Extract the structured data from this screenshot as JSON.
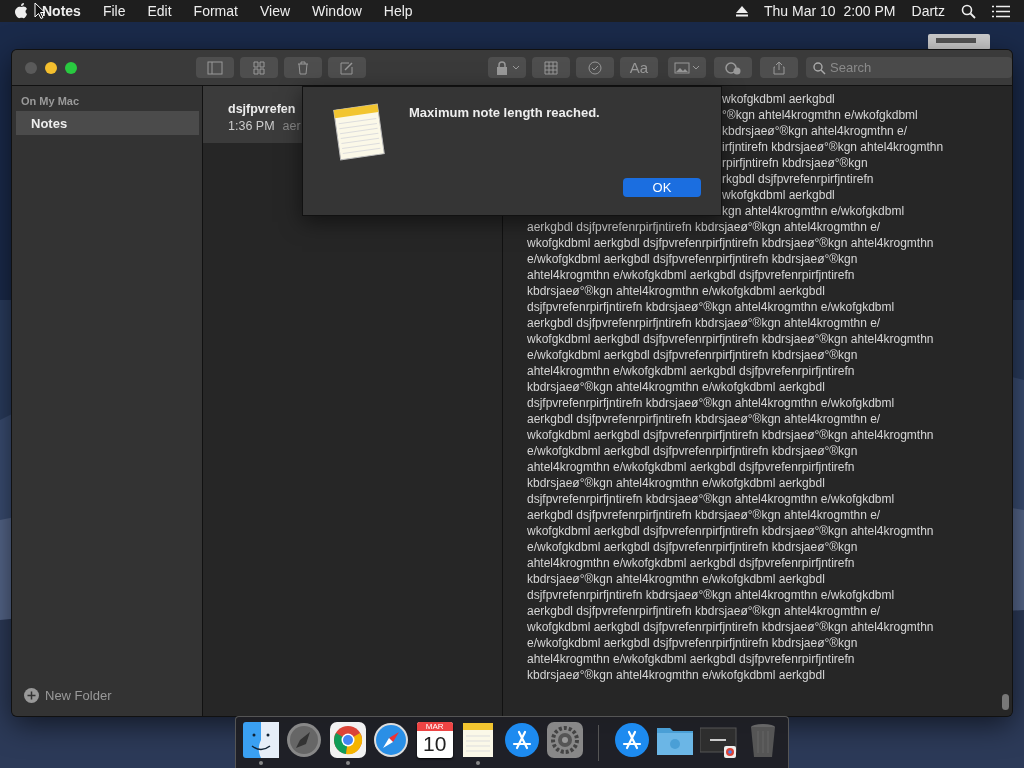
{
  "menu_bar": {
    "app_name": "Notes",
    "menus": [
      "File",
      "Edit",
      "Format",
      "View",
      "Window",
      "Help"
    ],
    "clock": "Thu Mar 10  2:00 PM",
    "user": "Dartz"
  },
  "toolbar": {
    "format_button": "Aa",
    "search": {
      "placeholder": "Search"
    }
  },
  "sidebar": {
    "section": "On My Mac",
    "folders": [
      {
        "name": "Notes",
        "selected": true
      }
    ],
    "new_folder": "New Folder"
  },
  "note_list": [
    {
      "title": "dsjfpvrefen",
      "time": "1:36 PM",
      "preview": "aer",
      "selected": true
    }
  ],
  "note": {
    "lines": [
      {
        "kind": "cut",
        "text": "wkofgkdbml aerkgbdl"
      },
      {
        "kind": "cut",
        "text": "°®kgn ahtel4krogmthn e/wkofgkdbml"
      },
      {
        "kind": "cut",
        "text": "kbdrsjaeø°®kgn ahtel4krogmthn e/"
      },
      {
        "kind": "cut",
        "text": "irfjntirefn kbdrsjaeø°®kgn ahtel4krogmthn"
      },
      {
        "kind": "cut",
        "text": "rpirfjntirefn kbdrsjaeø°®kgn"
      },
      {
        "kind": "cut",
        "text": "rkgbdl dsjfpvrefenrpirfjntirefn"
      },
      {
        "kind": "cut",
        "text": "wkofgkdbml aerkgbdl"
      },
      {
        "kind": "cut",
        "text": "kgn ahtel4krogmthn e/wkofgkdbml"
      },
      {
        "kind": "full",
        "text": "aerkgbdl dsjfpvrefenrpirfjntirefn kbdrsjaeø°®kgn ahtel4krogmthn e/"
      },
      {
        "kind": "full",
        "text": "wkofgkdbml aerkgbdl dsjfpvrefenrpirfjntirefn kbdrsjaeø°®kgn ahtel4krogmthn"
      },
      {
        "kind": "full",
        "text": "e/wkofgkdbml aerkgbdl dsjfpvrefenrpirfjntirefn kbdrsjaeø°®kgn"
      },
      {
        "kind": "full",
        "text": "ahtel4krogmthn e/wkofgkdbml aerkgbdl dsjfpvrefenrpirfjntirefn"
      },
      {
        "kind": "full",
        "text": "kbdrsjaeø°®kgn ahtel4krogmthn e/wkofgkdbml aerkgbdl"
      },
      {
        "kind": "full",
        "text": "dsjfpvrefenrpirfjntirefn kbdrsjaeø°®kgn ahtel4krogmthn e/wkofgkdbml"
      },
      {
        "kind": "full",
        "text": "aerkgbdl dsjfpvrefenrpirfjntirefn kbdrsjaeø°®kgn ahtel4krogmthn e/"
      },
      {
        "kind": "full",
        "text": "wkofgkdbml aerkgbdl dsjfpvrefenrpirfjntirefn kbdrsjaeø°®kgn ahtel4krogmthn"
      },
      {
        "kind": "full",
        "text": "e/wkofgkdbml aerkgbdl dsjfpvrefenrpirfjntirefn kbdrsjaeø°®kgn"
      },
      {
        "kind": "full",
        "text": "ahtel4krogmthn e/wkofgkdbml aerkgbdl dsjfpvrefenrpirfjntirefn"
      },
      {
        "kind": "full",
        "text": "kbdrsjaeø°®kgn ahtel4krogmthn e/wkofgkdbml aerkgbdl"
      },
      {
        "kind": "full",
        "text": "dsjfpvrefenrpirfjntirefn kbdrsjaeø°®kgn ahtel4krogmthn e/wkofgkdbml"
      },
      {
        "kind": "full",
        "text": "aerkgbdl dsjfpvrefenrpirfjntirefn kbdrsjaeø°®kgn ahtel4krogmthn e/"
      },
      {
        "kind": "full",
        "text": "wkofgkdbml aerkgbdl dsjfpvrefenrpirfjntirefn kbdrsjaeø°®kgn ahtel4krogmthn"
      },
      {
        "kind": "full",
        "text": "e/wkofgkdbml aerkgbdl dsjfpvrefenrpirfjntirefn kbdrsjaeø°®kgn"
      },
      {
        "kind": "full",
        "text": "ahtel4krogmthn e/wkofgkdbml aerkgbdl dsjfpvrefenrpirfjntirefn"
      },
      {
        "kind": "full",
        "text": "kbdrsjaeø°®kgn ahtel4krogmthn e/wkofgkdbml aerkgbdl"
      },
      {
        "kind": "full",
        "text": "dsjfpvrefenrpirfjntirefn kbdrsjaeø°®kgn ahtel4krogmthn e/wkofgkdbml"
      },
      {
        "kind": "full",
        "text": "aerkgbdl dsjfpvrefenrpirfjntirefn kbdrsjaeø°®kgn ahtel4krogmthn e/"
      },
      {
        "kind": "full",
        "text": "wkofgkdbml aerkgbdl dsjfpvrefenrpirfjntirefn kbdrsjaeø°®kgn ahtel4krogmthn"
      },
      {
        "kind": "full",
        "text": "e/wkofgkdbml aerkgbdl dsjfpvrefenrpirfjntirefn kbdrsjaeø°®kgn"
      },
      {
        "kind": "full",
        "text": "ahtel4krogmthn e/wkofgkdbml aerkgbdl dsjfpvrefenrpirfjntirefn"
      },
      {
        "kind": "full",
        "text": "kbdrsjaeø°®kgn ahtel4krogmthn e/wkofgkdbml aerkgbdl"
      },
      {
        "kind": "full",
        "text": "dsjfpvrefenrpirfjntirefn kbdrsjaeø°®kgn ahtel4krogmthn e/wkofgkdbml"
      },
      {
        "kind": "full",
        "text": "aerkgbdl dsjfpvrefenrpirfjntirefn kbdrsjaeø°®kgn ahtel4krogmthn e/"
      },
      {
        "kind": "full",
        "text": "wkofgkdbml aerkgbdl dsjfpvrefenrpirfjntirefn kbdrsjaeø°®kgn ahtel4krogmthn"
      },
      {
        "kind": "full",
        "text": "e/wkofgkdbml aerkgbdl dsjfpvrefenrpirfjntirefn kbdrsjaeø°®kgn"
      },
      {
        "kind": "full",
        "text": "ahtel4krogmthn e/wkofgkdbml aerkgbdl dsjfpvrefenrpirfjntirefn"
      },
      {
        "kind": "full",
        "text": "kbdrsjaeø°®kgn ahtel4krogmthn e/wkofgkdbml aerkgbdl"
      }
    ]
  },
  "dialog": {
    "message": "Maximum note length reached.",
    "button": "OK"
  },
  "dock": {
    "items": [
      {
        "kind": "finder",
        "running": true
      },
      {
        "kind": "launchpad",
        "running": false
      },
      {
        "kind": "chrome",
        "running": true
      },
      {
        "kind": "safari",
        "running": false
      },
      {
        "kind": "calendar",
        "month": "MAR",
        "day": "10",
        "running": false
      },
      {
        "kind": "notes",
        "running": true
      },
      {
        "kind": "appstore",
        "running": false
      },
      {
        "kind": "settings",
        "running": false
      },
      {
        "kind": "separator"
      },
      {
        "kind": "appstore",
        "running": false
      },
      {
        "kind": "folder",
        "running": false
      },
      {
        "kind": "screenshot",
        "running": false
      },
      {
        "kind": "trash",
        "running": false
      }
    ]
  }
}
